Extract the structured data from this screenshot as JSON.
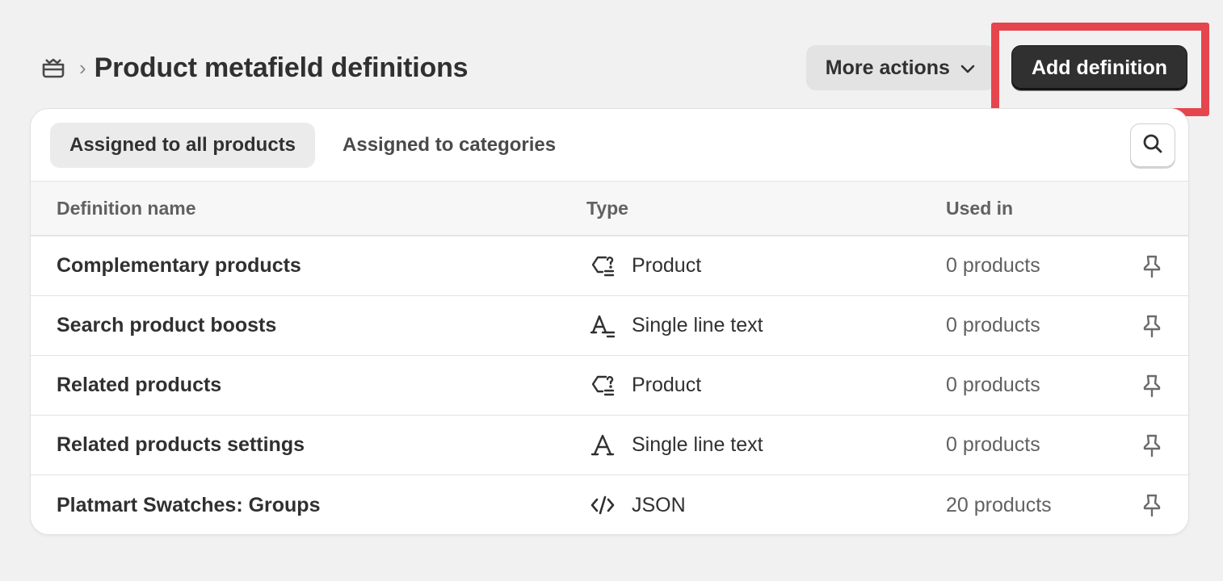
{
  "header": {
    "breadcrumb_icon": "metafield-icon",
    "separator": "›",
    "title": "Product metafield definitions",
    "more_actions_label": "More actions",
    "add_definition_label": "Add definition"
  },
  "tabs": [
    {
      "label": "Assigned to all products",
      "active": true
    },
    {
      "label": "Assigned to categories",
      "active": false
    }
  ],
  "table": {
    "columns": [
      "Definition name",
      "Type",
      "Used in"
    ],
    "rows": [
      {
        "name": "Complementary products",
        "type": "Product",
        "type_icon": "product-reference-icon",
        "used": "0 products"
      },
      {
        "name": "Search product boosts",
        "type": "Single line text",
        "type_icon": "single-line-text-icon",
        "used": "0 products"
      },
      {
        "name": "Related products",
        "type": "Product",
        "type_icon": "product-reference-icon",
        "used": "0 products"
      },
      {
        "name": "Related products settings",
        "type": "Single line text",
        "type_icon": "text-icon",
        "used": "0 products"
      },
      {
        "name": "Platmart Swatches: Groups",
        "type": "JSON",
        "type_icon": "code-icon",
        "used": "20 products"
      }
    ]
  },
  "colors": {
    "primary_button": "#303030",
    "highlight": "#e5454d",
    "background": "#f1f1f1"
  }
}
